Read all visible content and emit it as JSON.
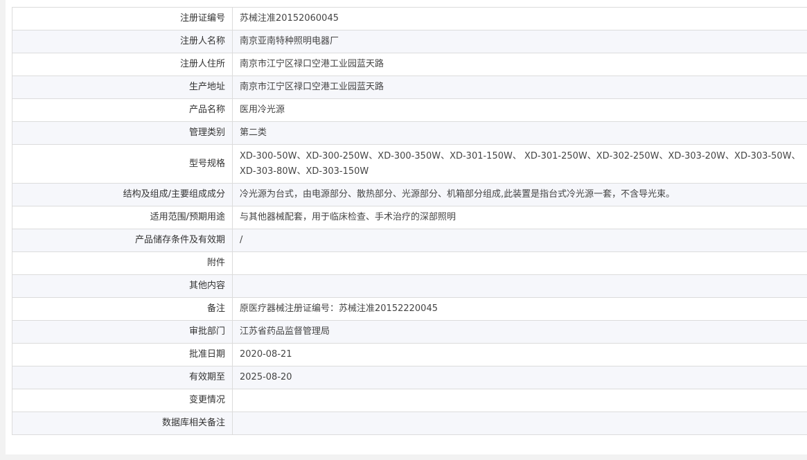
{
  "rows": [
    {
      "label": "注册证编号",
      "value": "苏械注准20152060045"
    },
    {
      "label": "注册人名称",
      "value": "南京亚南特种照明电器厂"
    },
    {
      "label": "注册人住所",
      "value": "南京市江宁区禄口空港工业园蓝天路"
    },
    {
      "label": "生产地址",
      "value": "南京市江宁区禄口空港工业园蓝天路"
    },
    {
      "label": "产品名称",
      "value": "医用冷光源"
    },
    {
      "label": "管理类别",
      "value": "第二类"
    },
    {
      "label": "型号规格",
      "value": "XD-300-50W、XD-300-250W、XD-300-350W、XD-301-150W、 XD-301-250W、XD-302-250W、XD-303-20W、XD-303-50W、XD-303-80W、XD-303-150W"
    },
    {
      "label": "结构及组成/主要组成成分",
      "value": "冷光源为台式，由电源部分、散热部分、光源部分、机箱部分组成,此装置是指台式冷光源一套，不含导光束。"
    },
    {
      "label": "适用范围/预期用途",
      "value": "与其他器械配套，用于临床检查、手术治疗的深部照明"
    },
    {
      "label": "产品储存条件及有效期",
      "value": "/"
    },
    {
      "label": "附件",
      "value": ""
    },
    {
      "label": "其他内容",
      "value": ""
    },
    {
      "label": "备注",
      "value": "原医疗器械注册证编号：苏械注准20152220045"
    },
    {
      "label": "审批部门",
      "value": "江苏省药品监督管理局"
    },
    {
      "label": "批准日期",
      "value": "2020-08-21"
    },
    {
      "label": "有效期至",
      "value": "2025-08-20"
    },
    {
      "label": "变更情况",
      "value": ""
    },
    {
      "label": "数据库相关备注",
      "value": ""
    }
  ]
}
